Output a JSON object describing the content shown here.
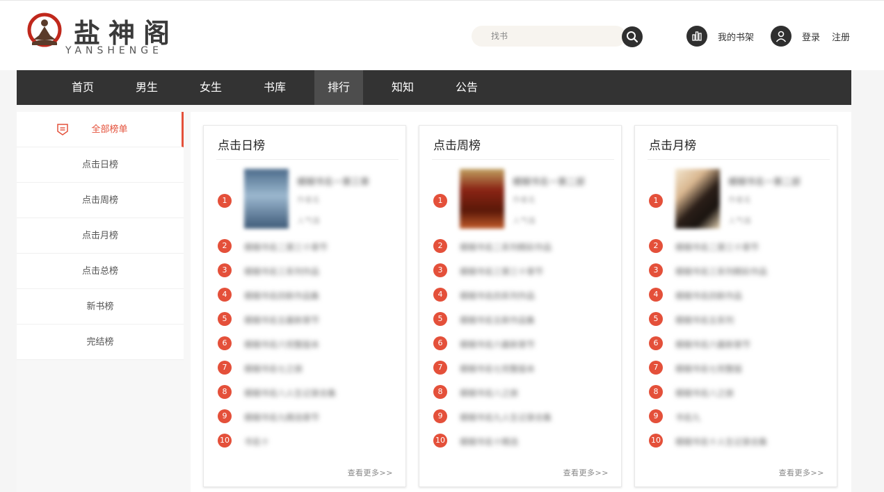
{
  "brand": {
    "title": "盐神阁",
    "subtitle": "YANSHENGE"
  },
  "search": {
    "placeholder": "找书"
  },
  "header": {
    "shelf_label": "我的书架",
    "login_label": "登录",
    "register_label": "注册"
  },
  "nav": {
    "items": [
      "首页",
      "男生",
      "女生",
      "书库",
      "排行",
      "知知",
      "公告"
    ],
    "active": "排行"
  },
  "sidebar": {
    "items": [
      "全部榜单",
      "点击日榜",
      "点击周榜",
      "点击月榜",
      "点击总榜",
      "新书榜",
      "完结榜"
    ],
    "active": "全部榜单"
  },
  "panels": [
    {
      "title": "点击日榜",
      "ranks": [
        "1",
        "2",
        "3",
        "4",
        "5",
        "6",
        "7",
        "8",
        "9",
        "10"
      ],
      "more": "查看更多>>",
      "first_book": {
        "title": "模糊书名一第三章",
        "author": "作者名",
        "count": "人气值"
      },
      "rows": [
        "模糊书名二第三十章节",
        "模糊书名三系列作品",
        "模糊书名四新作品集",
        "模糊书名五最新章节",
        "模糊书名六完整版本",
        "模糊书名七之旅",
        "模糊书名八人生记录合集",
        "模糊书名九精选章节",
        "书名十"
      ]
    },
    {
      "title": "点击周榜",
      "ranks": [
        "1",
        "2",
        "3",
        "4",
        "5",
        "6",
        "7",
        "8",
        "9",
        "10"
      ],
      "more": "查看更多>>",
      "first_book": {
        "title": "模糊书名一第二部",
        "author": "作者名",
        "count": "人气值"
      },
      "rows": [
        "模糊书名二系列精彩作品",
        "模糊书名三第三十章节",
        "模糊书名四系列作品",
        "模糊书名五新作品集",
        "模糊书名六最新章节",
        "模糊书名七完整版本",
        "模糊书名八之旅",
        "模糊书名九人生记录合集",
        "模糊书名十精选"
      ]
    },
    {
      "title": "点击月榜",
      "ranks": [
        "1",
        "2",
        "3",
        "4",
        "5",
        "6",
        "7",
        "8",
        "9",
        "10"
      ],
      "more": "查看更多>>",
      "first_book": {
        "title": "模糊书名一第二部",
        "author": "作者名",
        "count": "人气值"
      },
      "rows": [
        "模糊书名二第三十章节",
        "模糊书名三系列精彩作品",
        "模糊书名四新作品",
        "模糊书名五系列",
        "模糊书名六最新章节",
        "模糊书名七完整版",
        "模糊书名八之旅",
        "书名九",
        "模糊书名十人生记录合集"
      ]
    }
  ],
  "colors": {
    "accent": "#e4503a",
    "nav_bg": "#333333",
    "nav_active": "#4d4d4d"
  }
}
